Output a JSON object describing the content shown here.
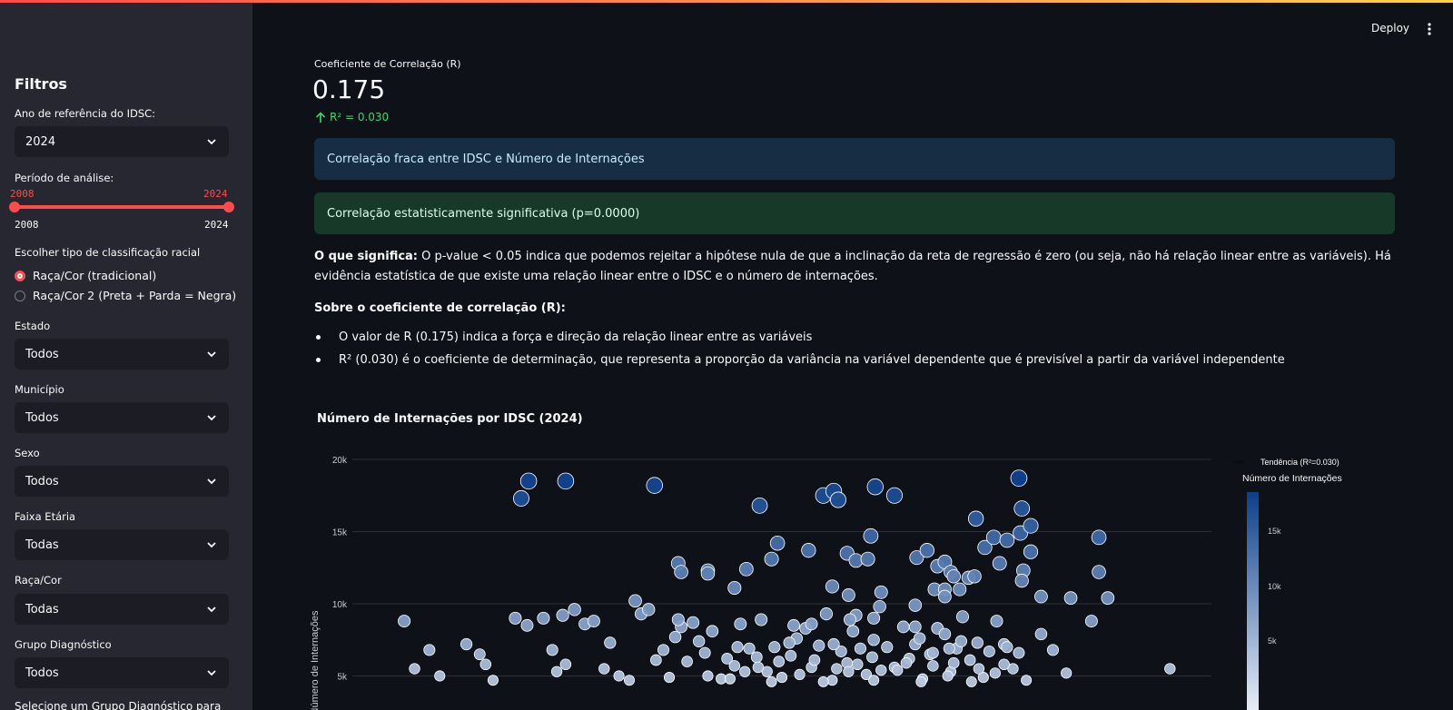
{
  "header": {
    "deploy_label": "Deploy",
    "menu_icon": "kebab-icon"
  },
  "sidebar": {
    "title": "Filtros",
    "ano": {
      "label": "Ano de referência do IDSC:",
      "value": "2024"
    },
    "periodo": {
      "label": "Período de análise:",
      "low": "2008",
      "high": "2024",
      "min": "2008",
      "max": "2024"
    },
    "classificacao": {
      "label": "Escolher tipo de classificação racial",
      "options": [
        "Raça/Cor (tradicional)",
        "Raça/Cor 2 (Preta + Parda = Negra)"
      ],
      "selected_index": 0
    },
    "estado": {
      "label": "Estado",
      "value": "Todos"
    },
    "municipio": {
      "label": "Município",
      "value": "Todos"
    },
    "sexo": {
      "label": "Sexo",
      "value": "Todos"
    },
    "faixa": {
      "label": "Faixa Etária",
      "value": "Todas"
    },
    "raca": {
      "label": "Raça/Cor",
      "value": "Todas"
    },
    "grupo": {
      "label": "Grupo Diagnóstico",
      "value": "Todos"
    },
    "cut_text": "Selecione um Grupo Diagnóstico para"
  },
  "metric": {
    "label": "Coeficiente de Correlação (R)",
    "value": "0.175",
    "delta": "R² = 0.030",
    "delta_color": "#3dd56d"
  },
  "alerts": {
    "info": "Correlação fraca entre IDSC e Número de Internações",
    "success": "Correlação estatisticamente significativa (p=0.0000)"
  },
  "explain": {
    "bold": "O que significa:",
    "text": " O p-value < 0.05 indica que podemos rejeitar a hipótese nula de que a inclinação da reta de regressão é zero (ou seja, não há relação linear entre as variáveis). Há evidência estatística de que existe uma relação linear entre o IDSC e o número de internações.",
    "subtitle": "Sobre o coeficiente de correlação (R):",
    "bullets": [
      "O valor de R (0.175) indica a força e direção da relação linear entre as variáveis",
      "R² (0.030) é o coeficiente de determinação, que representa a proporção da variância na variável dependente que é previsível a partir da variável independente"
    ]
  },
  "chart_data": {
    "type": "scatter",
    "title": "Número de Internações por IDSC (2024)",
    "xlabel": "",
    "ylabel": "Número de Internações",
    "ylim": [
      0,
      20000
    ],
    "y_ticks": [
      "5k",
      "10k",
      "15k",
      "20k"
    ],
    "legend": {
      "trend_label": "Tendência (R²=0.030)",
      "colorbar_title": "Número de Internações",
      "colorbar_ticks": [
        "5k",
        "10k",
        "15k"
      ],
      "position": "right"
    },
    "colorscale": [
      "#f0f4fb",
      "#0b3f8c"
    ],
    "points": [
      [
        0.295,
        8800
      ],
      [
        0.312,
        6800
      ],
      [
        0.302,
        5500
      ],
      [
        0.319,
        5000
      ],
      [
        0.337,
        7200
      ],
      [
        0.346,
        6500
      ],
      [
        0.35,
        5800
      ],
      [
        0.355,
        4700
      ],
      [
        0.37,
        9000
      ],
      [
        0.378,
        8500
      ],
      [
        0.389,
        9000
      ],
      [
        0.395,
        6800
      ],
      [
        0.398,
        5300
      ],
      [
        0.402,
        9200
      ],
      [
        0.404,
        5800
      ],
      [
        0.41,
        9600
      ],
      [
        0.417,
        8600
      ],
      [
        0.423,
        8800
      ],
      [
        0.43,
        5500
      ],
      [
        0.434,
        7300
      ],
      [
        0.44,
        5000
      ],
      [
        0.447,
        4700
      ],
      [
        0.451,
        10200
      ],
      [
        0.455,
        9300
      ],
      [
        0.46,
        9600
      ],
      [
        0.465,
        6100
      ],
      [
        0.47,
        6800
      ],
      [
        0.474,
        4900
      ],
      [
        0.478,
        7700
      ],
      [
        0.482,
        8400
      ],
      [
        0.486,
        6000
      ],
      [
        0.49,
        8700
      ],
      [
        0.494,
        7400
      ],
      [
        0.498,
        6600
      ],
      [
        0.503,
        8100
      ],
      [
        0.509,
        4800
      ],
      [
        0.513,
        6200
      ],
      [
        0.518,
        5700
      ],
      [
        0.522,
        8600
      ],
      [
        0.528,
        6900
      ],
      [
        0.533,
        6300
      ],
      [
        0.536,
        8900
      ],
      [
        0.54,
        5300
      ],
      [
        0.545,
        7000
      ],
      [
        0.55,
        4900
      ],
      [
        0.556,
        6400
      ],
      [
        0.56,
        7600
      ],
      [
        0.566,
        8300
      ],
      [
        0.57,
        5600
      ],
      [
        0.575,
        7100
      ],
      [
        0.58,
        9300
      ],
      [
        0.584,
        4700
      ],
      [
        0.59,
        6700
      ],
      [
        0.594,
        5900
      ],
      [
        0.598,
        8100
      ],
      [
        0.603,
        6900
      ],
      [
        0.607,
        5100
      ],
      [
        0.611,
        6300
      ],
      [
        0.616,
        9800
      ],
      [
        0.621,
        7000
      ],
      [
        0.626,
        5600
      ],
      [
        0.632,
        8400
      ],
      [
        0.636,
        6200
      ],
      [
        0.64,
        7200
      ],
      [
        0.645,
        4800
      ],
      [
        0.65,
        6500
      ],
      [
        0.655,
        8300
      ],
      [
        0.66,
        7900
      ],
      [
        0.664,
        5300
      ],
      [
        0.668,
        6900
      ],
      [
        0.672,
        9100
      ],
      [
        0.677,
        6100
      ],
      [
        0.682,
        7300
      ],
      [
        0.686,
        4900
      ],
      [
        0.69,
        6700
      ],
      [
        0.695,
        8800
      ],
      [
        0.7,
        7200
      ],
      [
        0.706,
        5500
      ],
      [
        0.71,
        6600
      ],
      [
        0.715,
        4700
      ],
      [
        0.5,
        5000
      ],
      [
        0.515,
        4800
      ],
      [
        0.525,
        5300
      ],
      [
        0.543,
        4600
      ],
      [
        0.562,
        5100
      ],
      [
        0.578,
        4600
      ],
      [
        0.595,
        5300
      ],
      [
        0.612,
        4700
      ],
      [
        0.628,
        5400
      ],
      [
        0.644,
        4600
      ],
      [
        0.662,
        5000
      ],
      [
        0.678,
        4600
      ],
      [
        0.694,
        5200
      ],
      [
        0.534,
        5600
      ],
      [
        0.587,
        5500
      ],
      [
        0.601,
        5800
      ],
      [
        0.617,
        5400
      ],
      [
        0.634,
        5900
      ],
      [
        0.652,
        5700
      ],
      [
        0.666,
        5900
      ],
      [
        0.683,
        5500
      ],
      [
        0.7,
        5800
      ],
      [
        0.548,
        6000
      ],
      [
        0.572,
        6100
      ],
      [
        0.52,
        7000
      ],
      [
        0.555,
        7300
      ],
      [
        0.585,
        7200
      ],
      [
        0.612,
        7500
      ],
      [
        0.643,
        7600
      ],
      [
        0.671,
        7400
      ],
      [
        0.702,
        7000
      ],
      [
        0.725,
        7900
      ],
      [
        0.733,
        6800
      ],
      [
        0.742,
        5200
      ],
      [
        0.759,
        8800
      ],
      [
        0.812,
        5500
      ],
      [
        0.745,
        10400
      ],
      [
        0.77,
        10400
      ],
      [
        0.374,
        17300
      ],
      [
        0.379,
        18500
      ],
      [
        0.404,
        18500
      ],
      [
        0.464,
        18200
      ],
      [
        0.535,
        16800
      ],
      [
        0.578,
        17500
      ],
      [
        0.585,
        17800
      ],
      [
        0.588,
        17200
      ],
      [
        0.613,
        18100
      ],
      [
        0.626,
        17500
      ],
      [
        0.71,
        18700
      ],
      [
        0.712,
        16600
      ],
      [
        0.711,
        14900
      ],
      [
        0.718,
        15400
      ],
      [
        0.764,
        14600
      ],
      [
        0.547,
        14200
      ],
      [
        0.543,
        13100
      ],
      [
        0.526,
        12400
      ],
      [
        0.5,
        12300
      ],
      [
        0.48,
        12800
      ],
      [
        0.482,
        12200
      ],
      [
        0.5,
        12100
      ],
      [
        0.518,
        11100
      ],
      [
        0.568,
        13700
      ],
      [
        0.594,
        13500
      ],
      [
        0.6,
        13000
      ],
      [
        0.608,
        13100
      ],
      [
        0.61,
        14700
      ],
      [
        0.641,
        13200
      ],
      [
        0.648,
        13700
      ],
      [
        0.655,
        12600
      ],
      [
        0.66,
        12900
      ],
      [
        0.664,
        12200
      ],
      [
        0.666,
        11900
      ],
      [
        0.681,
        15900
      ],
      [
        0.687,
        13900
      ],
      [
        0.693,
        14600
      ],
      [
        0.697,
        12800
      ],
      [
        0.702,
        14400
      ],
      [
        0.718,
        13600
      ],
      [
        0.713,
        12300
      ],
      [
        0.712,
        11600
      ],
      [
        0.676,
        11800
      ],
      [
        0.68,
        11900
      ],
      [
        0.653,
        11000
      ],
      [
        0.66,
        11000
      ],
      [
        0.67,
        11000
      ],
      [
        0.725,
        10500
      ],
      [
        0.64,
        9900
      ],
      [
        0.617,
        10800
      ],
      [
        0.66,
        10500
      ],
      [
        0.584,
        11200
      ],
      [
        0.595,
        10600
      ],
      [
        0.764,
        12200
      ],
      [
        0.48,
        8900
      ],
      [
        0.64,
        8400
      ],
      [
        0.652,
        6600
      ],
      [
        0.663,
        6900
      ],
      [
        0.6,
        9200
      ],
      [
        0.596,
        8900
      ],
      [
        0.612,
        9000
      ],
      [
        0.558,
        8500
      ],
      [
        0.57,
        8600
      ]
    ],
    "x_range": [
      0.26,
      0.84
    ],
    "trend_color": "#0b0b12"
  }
}
